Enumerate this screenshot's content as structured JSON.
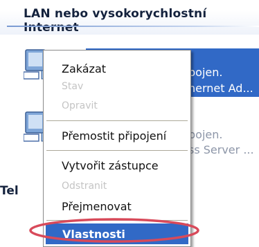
{
  "group": {
    "title": "LAN nebo vysokorychlostní Internet"
  },
  "connections": [
    {
      "line1": "pojen.",
      "line2": "hernet Ad...",
      "selected": true
    },
    {
      "line1": "pojen.",
      "line2": "ss Server ...",
      "selected": false
    }
  ],
  "next_section": {
    "title_fragment": "Tel"
  },
  "context_menu": {
    "items": [
      {
        "label": "Zakázat",
        "enabled": true
      },
      {
        "label": "Stav",
        "enabled": false
      },
      {
        "label": "Opravit",
        "enabled": false
      },
      {
        "label": "Přemostit připojení",
        "enabled": true
      },
      {
        "label": "Vytvořit zástupce",
        "enabled": true
      },
      {
        "label": "Odstranit",
        "enabled": false
      },
      {
        "label": "Přejmenovat",
        "enabled": true
      },
      {
        "label": "Vlastnosti",
        "enabled": true,
        "default": true,
        "highlighted": true
      }
    ]
  },
  "colors": {
    "selection": "#3169c6",
    "annotation_ellipse": "#d84a5a",
    "group_line": "#7a9ad2",
    "disabled_text": "#c4c4c4"
  },
  "icons": [
    "network-connection-icon",
    "network-connection-icon"
  ]
}
